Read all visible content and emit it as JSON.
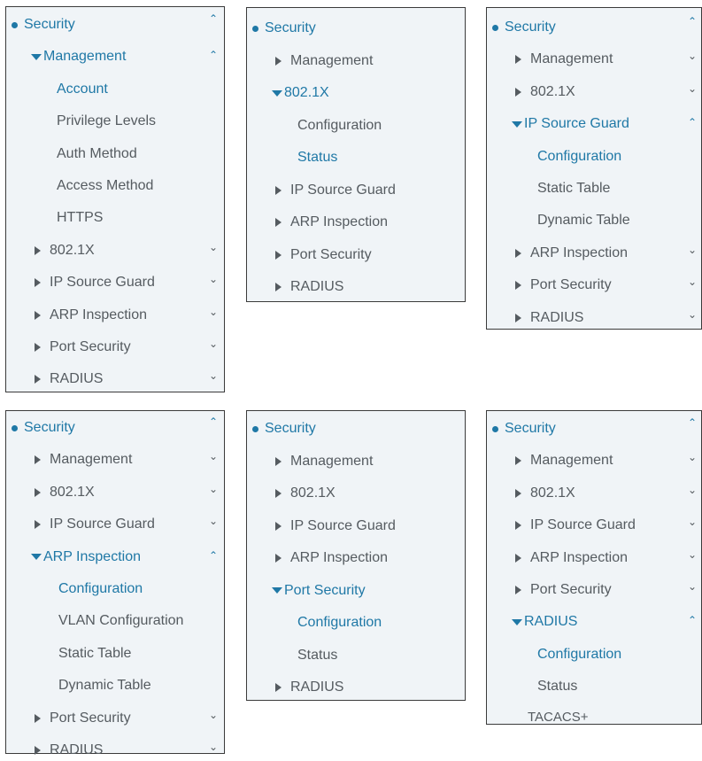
{
  "colors": {
    "accent": "#1f78a6",
    "text": "#555b60",
    "panel_bg": "#f0f4f7",
    "border": "#3b3b3b"
  },
  "icons": {
    "expanded": "chevron-up-icon",
    "collapsed": "chevron-down-icon",
    "caret_closed": "caret-right-icon",
    "caret_open": "caret-down-icon",
    "root": "bullet-icon"
  },
  "panels": [
    {
      "root": "Security",
      "items": [
        {
          "label": "Management",
          "expanded": true,
          "children": [
            {
              "label": "Account",
              "active": true
            },
            {
              "label": "Privilege Levels"
            },
            {
              "label": "Auth Method"
            },
            {
              "label": "Access Method"
            },
            {
              "label": "HTTPS"
            }
          ]
        },
        {
          "label": "802.1X"
        },
        {
          "label": "IP Source Guard"
        },
        {
          "label": "ARP Inspection"
        },
        {
          "label": "Port Security"
        },
        {
          "label": "RADIUS"
        }
      ]
    },
    {
      "root": "Security",
      "items": [
        {
          "label": "Management"
        },
        {
          "label": "802.1X",
          "expanded": true,
          "children": [
            {
              "label": "Configuration"
            },
            {
              "label": "Status",
              "active": true
            }
          ]
        },
        {
          "label": "IP Source Guard"
        },
        {
          "label": "ARP Inspection"
        },
        {
          "label": "Port Security"
        },
        {
          "label": "RADIUS"
        }
      ]
    },
    {
      "root": "Security",
      "items": [
        {
          "label": "Management"
        },
        {
          "label": "802.1X"
        },
        {
          "label": "IP Source Guard",
          "expanded": true,
          "children": [
            {
              "label": "Configuration",
              "active": true
            },
            {
              "label": "Static Table"
            },
            {
              "label": "Dynamic Table"
            }
          ]
        },
        {
          "label": "ARP Inspection"
        },
        {
          "label": "Port Security"
        },
        {
          "label": "RADIUS"
        }
      ]
    },
    {
      "root": "Security",
      "items": [
        {
          "label": "Management"
        },
        {
          "label": "802.1X"
        },
        {
          "label": "IP Source Guard"
        },
        {
          "label": "ARP Inspection",
          "expanded": true,
          "children": [
            {
              "label": "Configuration",
              "active": true
            },
            {
              "label": "VLAN Configuration"
            },
            {
              "label": "Static Table"
            },
            {
              "label": "Dynamic Table"
            }
          ]
        },
        {
          "label": "Port Security"
        },
        {
          "label": "RADIUS"
        }
      ]
    },
    {
      "root": "Security",
      "items": [
        {
          "label": "Management"
        },
        {
          "label": "802.1X"
        },
        {
          "label": "IP Source Guard"
        },
        {
          "label": "ARP Inspection"
        },
        {
          "label": "Port Security",
          "expanded": true,
          "children": [
            {
              "label": "Configuration",
              "active": true
            },
            {
              "label": "Status"
            }
          ]
        },
        {
          "label": "RADIUS"
        }
      ]
    },
    {
      "root": "Security",
      "items": [
        {
          "label": "Management"
        },
        {
          "label": "802.1X"
        },
        {
          "label": "IP Source Guard"
        },
        {
          "label": "ARP Inspection"
        },
        {
          "label": "Port Security"
        },
        {
          "label": "RADIUS",
          "expanded": true,
          "children": [
            {
              "label": "Configuration",
              "active": true
            },
            {
              "label": "Status"
            }
          ]
        }
      ],
      "extra": "TACACS+"
    }
  ]
}
